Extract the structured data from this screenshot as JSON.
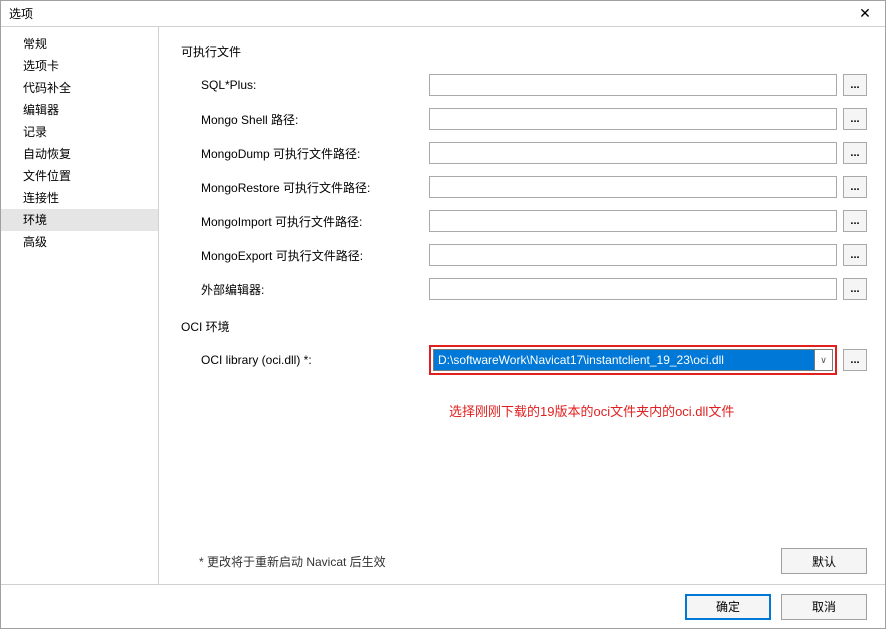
{
  "window": {
    "title": "选项"
  },
  "sidebar": {
    "items": [
      {
        "label": "常规"
      },
      {
        "label": "选项卡"
      },
      {
        "label": "代码补全"
      },
      {
        "label": "编辑器"
      },
      {
        "label": "记录"
      },
      {
        "label": "自动恢复"
      },
      {
        "label": "文件位置"
      },
      {
        "label": "连接性"
      },
      {
        "label": "环境",
        "selected": true
      },
      {
        "label": "高级"
      }
    ]
  },
  "sections": {
    "exec": {
      "title": "可执行文件",
      "rows": [
        {
          "label": "SQL*Plus:",
          "value": ""
        },
        {
          "label": "Mongo Shell 路径:",
          "value": ""
        },
        {
          "label": "MongoDump 可执行文件路径:",
          "value": ""
        },
        {
          "label": "MongoRestore 可执行文件路径:",
          "value": ""
        },
        {
          "label": "MongoImport 可执行文件路径:",
          "value": ""
        },
        {
          "label": "MongoExport 可执行文件路径:",
          "value": ""
        },
        {
          "label": "外部编辑器:",
          "value": ""
        }
      ]
    },
    "oci": {
      "title": "OCI 环境",
      "label": "OCI library (oci.dll) *:",
      "value": "D:\\softwareWork\\Navicat17\\instantclient_19_23\\oci.dll"
    }
  },
  "annotation": "选择刚刚下载的19版本的oci文件夹内的oci.dll文件",
  "footnote": "* 更改将于重新启动 Navicat 后生效",
  "buttons": {
    "default": "默认",
    "ok": "确定",
    "cancel": "取消"
  },
  "icons": {
    "browse": "...",
    "chevron": "∨",
    "close": "✕"
  }
}
